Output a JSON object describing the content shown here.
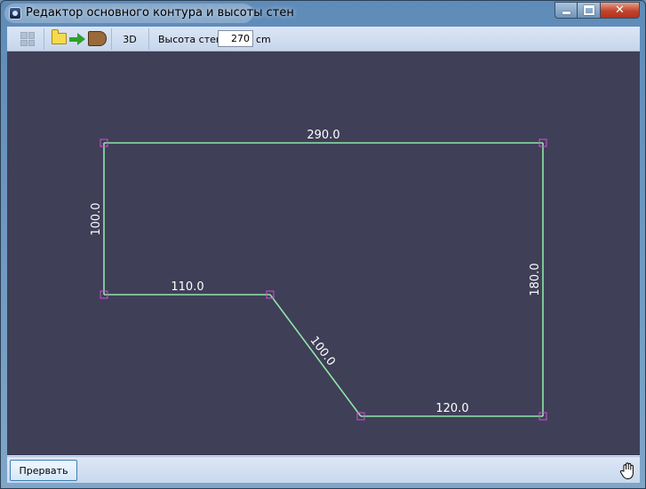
{
  "window": {
    "title": "Редактор основного контура и высоты стен",
    "close_glyph": "✕"
  },
  "toolbar": {
    "grid_icon": "grid-icon",
    "import_icon": "folder-import-icon",
    "room_icon": "room-shape-icon",
    "view3d_label": "3D",
    "wall_height_label": "Высота стен",
    "wall_height_value": "270",
    "unit_label": "cm"
  },
  "canvas": {
    "background": "#3f3f58",
    "line_color": "#8fe6a8",
    "vertex_color": "#d24fd4",
    "edges": [
      {
        "label": "290.0"
      },
      {
        "label": "180.0"
      },
      {
        "label": "120.0"
      },
      {
        "label": "100.0"
      },
      {
        "label": "110.0"
      },
      {
        "label": "100.0"
      }
    ]
  },
  "bottom": {
    "abort_label": "Прервать",
    "hand_icon": "hand-pan-icon"
  }
}
